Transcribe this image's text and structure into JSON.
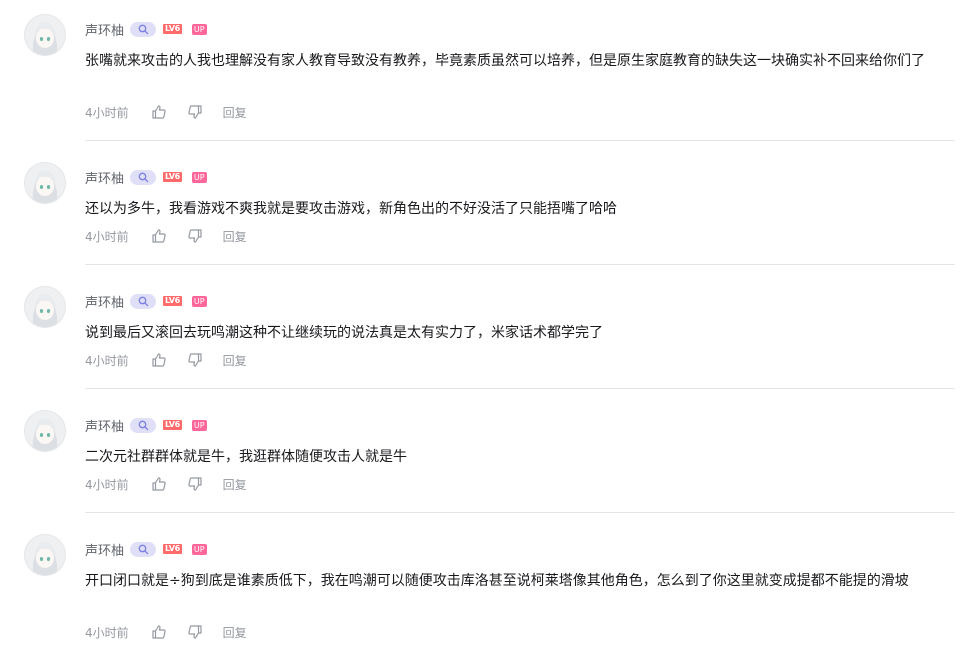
{
  "comments": [
    {
      "username": "声环柚",
      "level_badge": "LV6",
      "up_badge": "UP",
      "text": "张嘴就来攻击的人我也理解没有家人教育导致没有教养，毕竟素质虽然可以培养，但是原生家庭教育的缺失这一块确实补不回来给你们了",
      "time": "4小时前",
      "reply_label": "回复"
    },
    {
      "username": "声环柚",
      "level_badge": "LV6",
      "up_badge": "UP",
      "text": "还以为多牛，我看游戏不爽我就是要攻击游戏，新角色出的不好没活了只能捂嘴了哈哈",
      "time": "4小时前",
      "reply_label": "回复"
    },
    {
      "username": "声环柚",
      "level_badge": "LV6",
      "up_badge": "UP",
      "text": "说到最后又滚回去玩鸣潮这种不让继续玩的说法真是太有实力了，米家话术都学完了",
      "time": "4小时前",
      "reply_label": "回复"
    },
    {
      "username": "声环柚",
      "level_badge": "LV6",
      "up_badge": "UP",
      "text": "二次元社群群体就是牛，我逛群体随便攻击人就是牛",
      "time": "4小时前",
      "reply_label": "回复"
    },
    {
      "username": "声环柚",
      "level_badge": "LV6",
      "up_badge": "UP",
      "text": "开口闭口就是÷狗到底是谁素质低下，我在鸣潮可以随便攻击库洛甚至说柯莱塔像其他角色，怎么到了你这里就变成提都不能提的滑坡",
      "time": "4小时前",
      "reply_label": "回复"
    }
  ]
}
